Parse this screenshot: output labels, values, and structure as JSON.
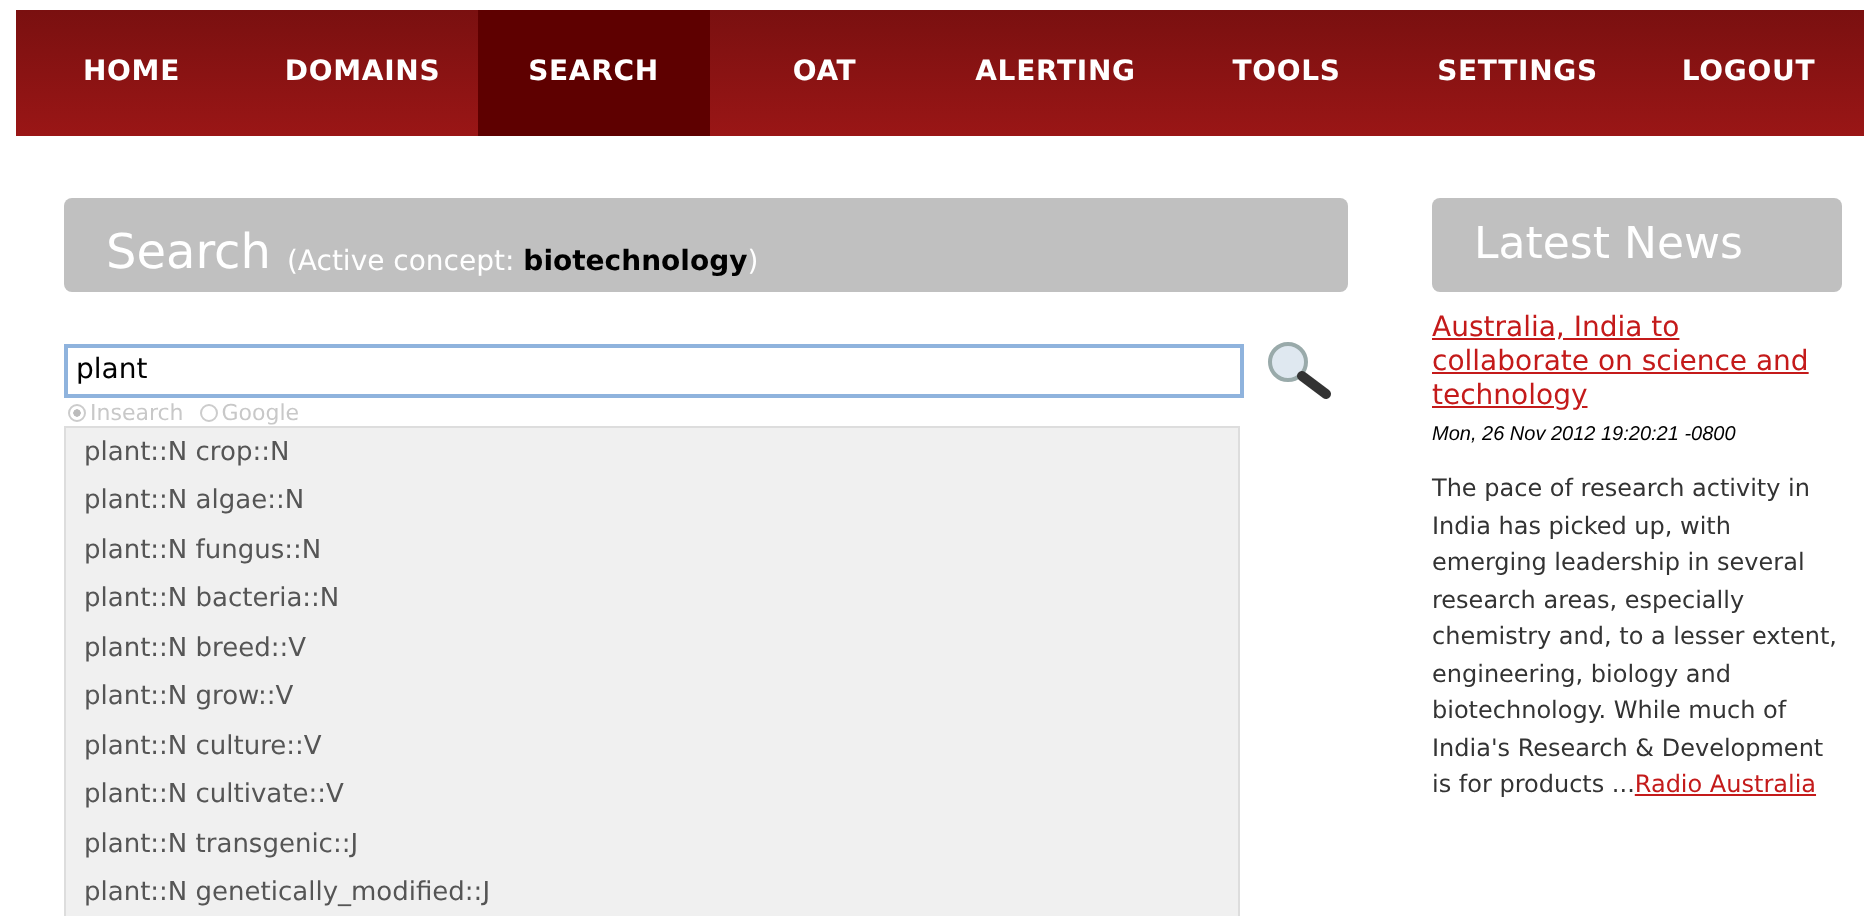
{
  "nav": [
    {
      "label": "HOME",
      "selected": false
    },
    {
      "label": "DOMAINS",
      "selected": false
    },
    {
      "label": "SEARCH",
      "selected": true
    },
    {
      "label": "OAT",
      "selected": false
    },
    {
      "label": "ALERTING",
      "selected": false
    },
    {
      "label": "TOOLS",
      "selected": false
    },
    {
      "label": "SETTINGS",
      "selected": false
    },
    {
      "label": "LOGOUT",
      "selected": false
    }
  ],
  "search": {
    "title": "Search",
    "concept_label": "(Active concept: **biotechnology**)",
    "value": "plant",
    "engines": [
      {
        "label": "Insearch",
        "selected": true
      },
      {
        "label": "Google",
        "selected": false
      }
    ],
    "suggestions": [
      "plant::N crop::N",
      "plant::N algae::N",
      "plant::N fungus::N",
      "plant::N bacteria::N",
      "plant::N breed::V",
      "plant::N grow::V",
      "plant::N culture::V",
      "plant::N cultivate::V",
      "plant::N transgenic::J",
      "plant::N genetically_modified::J"
    ]
  },
  "news": {
    "title": "Latest News",
    "headline": "Australia, India to collaborate on science and technology",
    "date": "Mon, 26 Nov 2012 19:20:21 -0800",
    "summary": "The pace of research activity in India has picked up, with emerging leadership in several research areas, especially chemistry and, to a lesser extent, engineering, biology and biotechnology. While much of India's Research & Development is for products ...",
    "source": "Radio Australia"
  }
}
